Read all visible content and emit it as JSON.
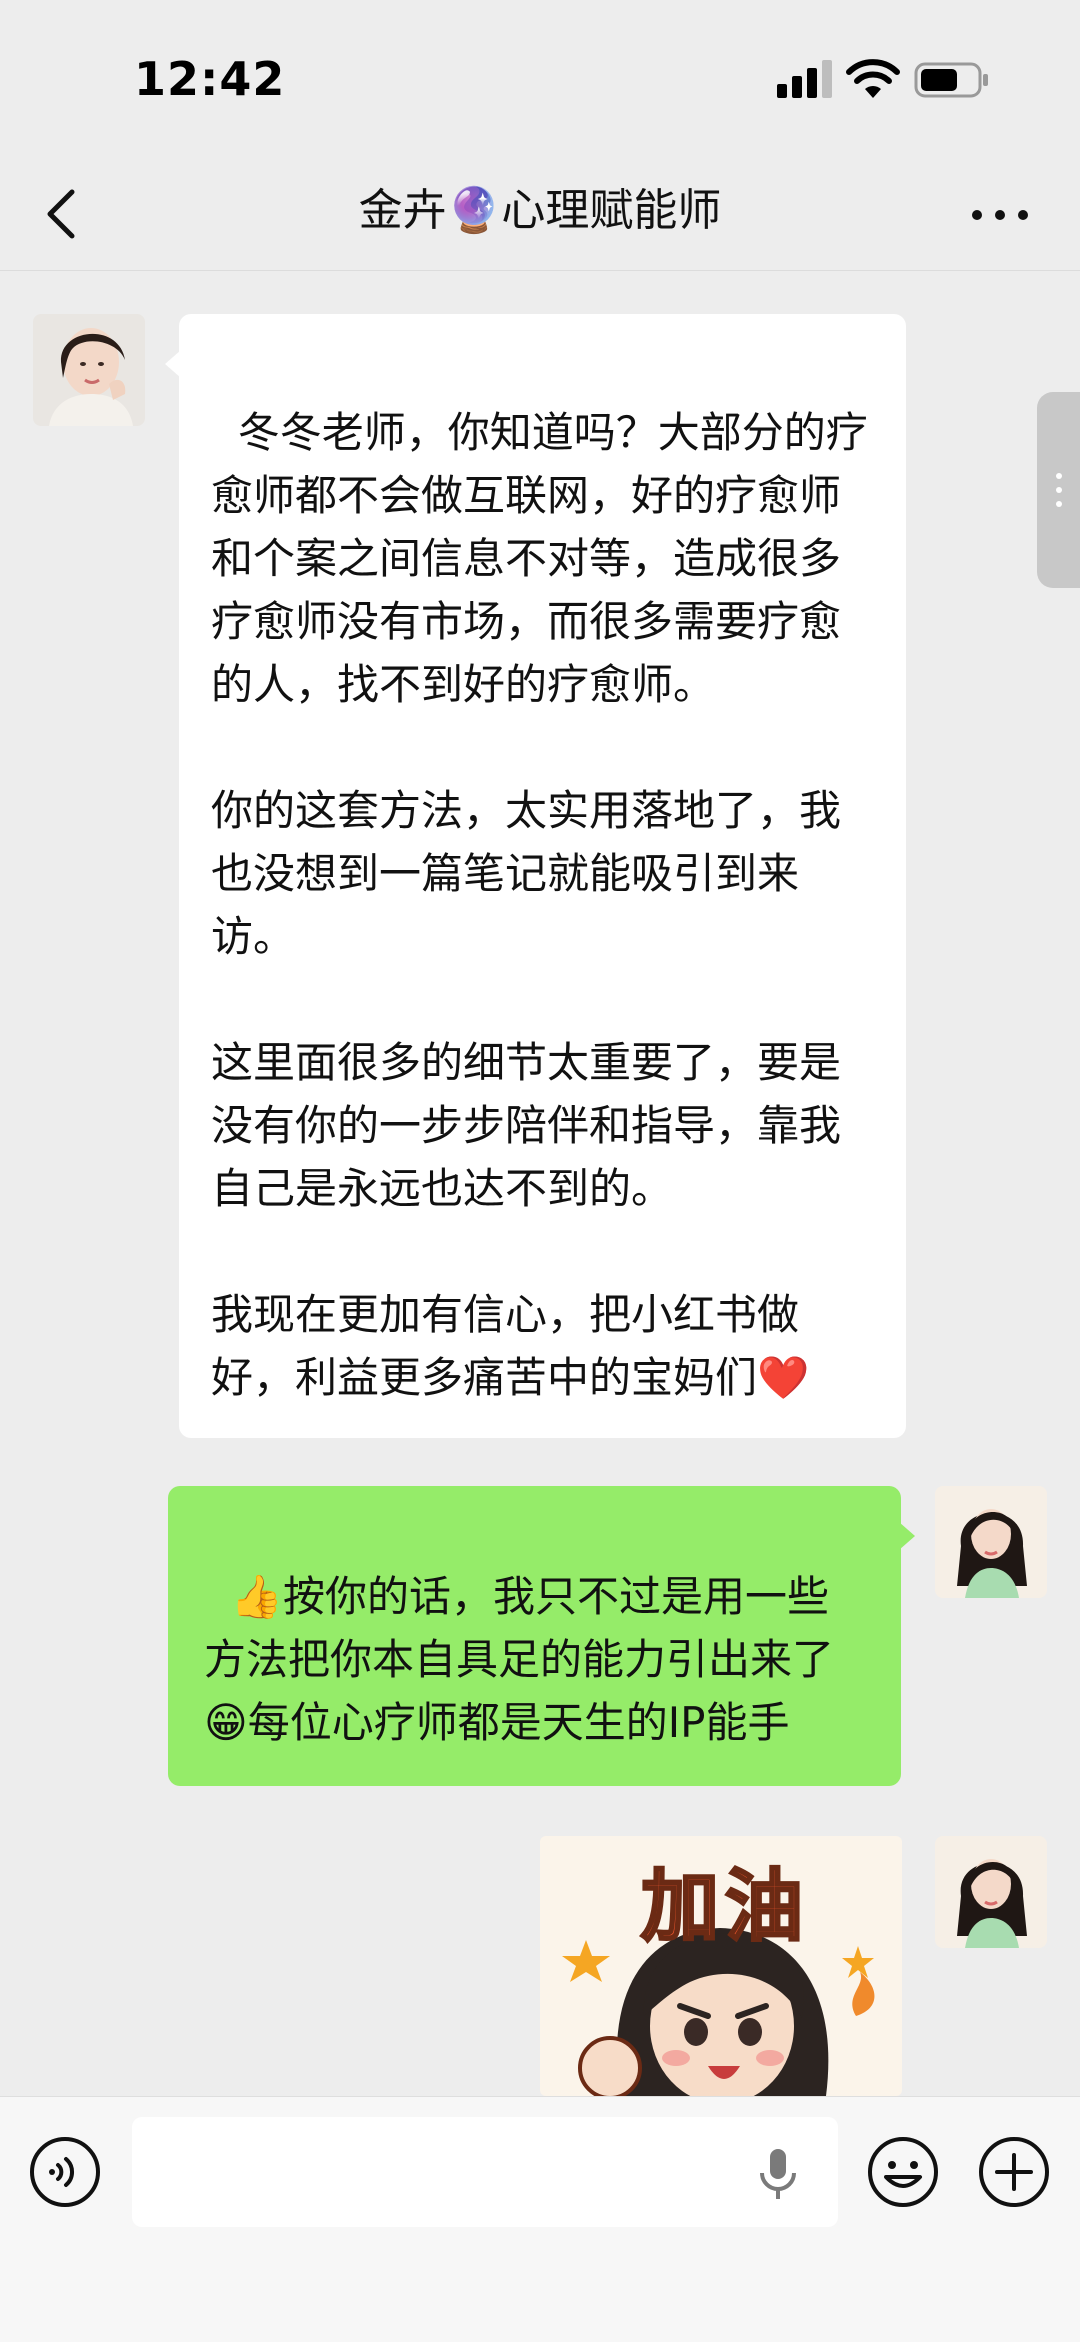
{
  "status_bar": {
    "time": "12:42"
  },
  "header": {
    "title": "金卉🔮心理赋能师"
  },
  "messages": [
    {
      "direction": "incoming",
      "type": "text",
      "text": "冬冬老师，你知道吗？大部分的疗愈师都不会做互联网，好的疗愈师和个案之间信息不对等，造成很多疗愈师没有市场，而很多需要疗愈的人，找不到好的疗愈师。\n\n你的这套方法，太实用落地了，我也没想到一篇笔记就能吸引到来访。\n\n这里面很多的细节太重要了，要是没有你的一步步陪伴和指导，靠我自己是永远也达不到的。\n\n我现在更加有信心，把小红书做好，利益更多痛苦中的宝妈们❤️"
    },
    {
      "direction": "outgoing",
      "type": "text",
      "text": "👍按你的话，我只不过是用一些方法把你本自具足的能力引出来了😁每位心疗师都是天生的IP能手"
    },
    {
      "direction": "outgoing",
      "type": "sticker",
      "text": "加油"
    }
  ],
  "icons": {
    "back": "chevron-left-icon",
    "more": "more-dots-icon",
    "voice": "voice-mode-icon",
    "mic": "microphone-icon",
    "emoji": "emoji-icon",
    "add": "plus-icon"
  },
  "colors": {
    "background": "#ededed",
    "outgoing_bubble": "#95ec69",
    "incoming_bubble": "#ffffff"
  }
}
